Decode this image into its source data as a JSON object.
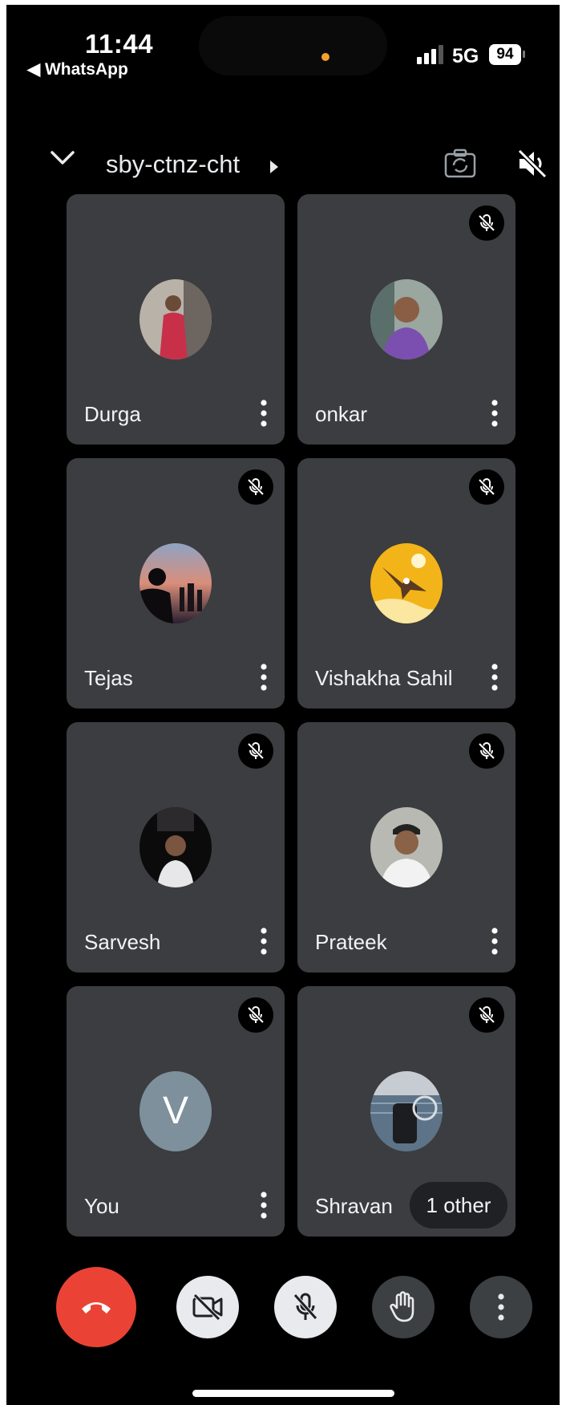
{
  "status_bar": {
    "time": "11:44",
    "back_app": "◀ WhatsApp",
    "network": "5G",
    "battery": "94"
  },
  "header": {
    "meeting_code": "sby-ctnz-cht"
  },
  "participants": [
    {
      "name": "Durga",
      "muted": false
    },
    {
      "name": "onkar",
      "muted": true
    },
    {
      "name": "Tejas",
      "muted": true
    },
    {
      "name": "Vishakha Sahil",
      "muted": true
    },
    {
      "name": "Sarvesh",
      "muted": true
    },
    {
      "name": "Prateek",
      "muted": true
    },
    {
      "name": "You",
      "muted": true,
      "initial": "V"
    },
    {
      "name": "Shravan",
      "muted": true,
      "badge": "1 other"
    }
  ],
  "controls": [
    "end-call",
    "camera-off",
    "mic-off",
    "raise-hand",
    "more-options"
  ],
  "colors": {
    "end_call": "#ea4335",
    "tile_bg": "#3c3d40",
    "background": "#000000"
  }
}
